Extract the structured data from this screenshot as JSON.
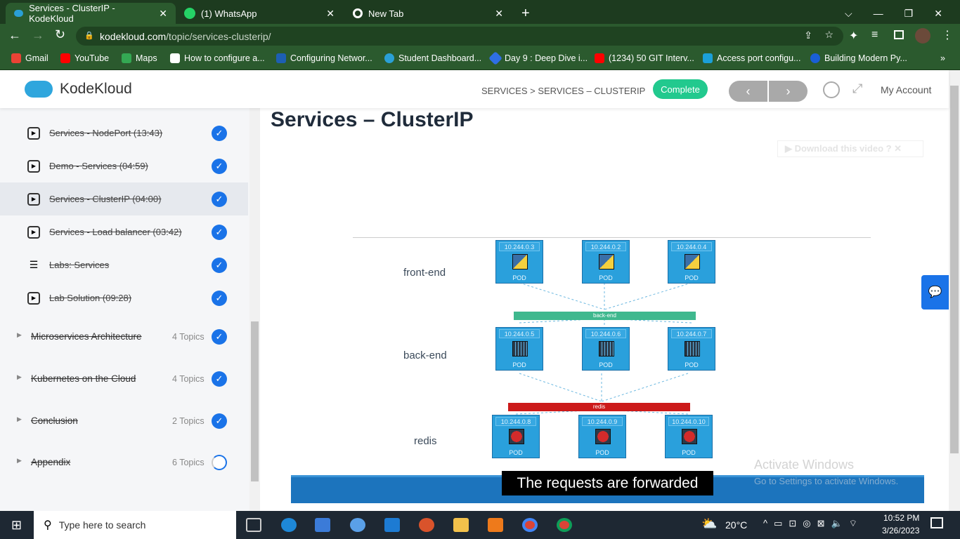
{
  "browser": {
    "tabs": [
      {
        "title": "Services - ClusterIP - KodeKloud",
        "active": true
      },
      {
        "title": "(1) WhatsApp"
      },
      {
        "title": "New Tab"
      }
    ],
    "url_domain": "kodekloud.com",
    "url_path": "/topic/services-clusterip/",
    "bookmarks": [
      "Gmail",
      "YouTube",
      "Maps",
      "How to configure a...",
      "Configuring Networ...",
      "Student Dashboard...",
      "Day 9 : Deep Dive i...",
      "(1234) 50 GIT Interv...",
      "Access port configu...",
      "Building Modern Py..."
    ]
  },
  "header": {
    "logo": "KodeKloud",
    "breadcrumb": "SERVICES > SERVICES – CLUSTERIP",
    "complete": "Complete",
    "prev": "‹",
    "next": "›",
    "account": "My Account"
  },
  "sidebar": {
    "lessons": [
      {
        "label": "Services - NodePort (13:43)",
        "type": "video",
        "done": true
      },
      {
        "label": "Demo - Services (04:59)",
        "type": "video",
        "done": true
      },
      {
        "label": "Services - ClusterIP (04:00)",
        "type": "video",
        "done": true,
        "active": true
      },
      {
        "label": "Services - Load balancer (03:42)",
        "type": "video",
        "done": true
      },
      {
        "label": "Labs: Services",
        "type": "lab",
        "done": true
      },
      {
        "label": "Lab Solution (09:28)",
        "type": "video",
        "done": true
      }
    ],
    "sections": [
      {
        "label": "Microservices Architecture",
        "count": "4 Topics",
        "status": "complete"
      },
      {
        "label": "Kubernetes on the Cloud",
        "count": "4 Topics",
        "status": "complete"
      },
      {
        "label": "Conclusion",
        "count": "2 Topics",
        "status": "complete"
      },
      {
        "label": "Appendix",
        "count": "6 Topics",
        "status": "in-progress"
      }
    ]
  },
  "main": {
    "title": "Services – ClusterIP",
    "download": "Download this video",
    "caption": "The requests are forwarded",
    "watermark": {
      "line1": "Activate Windows",
      "line2": "Go to Settings to activate Windows."
    },
    "diagram": {
      "tiers": [
        {
          "label": "front-end",
          "pods": [
            "10.244.0.3",
            "10.244.0.2",
            "10.244.0.4"
          ],
          "icon": "python"
        },
        {
          "label": "back-end",
          "pods": [
            "10.244.0.5",
            "10.244.0.6",
            "10.244.0.7"
          ],
          "icon": "app"
        },
        {
          "label": "redis",
          "pods": [
            "10.244.0.8",
            "10.244.0.9",
            "10.244.0.10"
          ],
          "icon": "redis"
        }
      ],
      "pod_label": "POD",
      "services": [
        {
          "label": "back-end",
          "color": "#3fb88e"
        },
        {
          "label": "redis",
          "color": "#cc1a1a"
        }
      ]
    }
  },
  "taskbar": {
    "search": "Type here to search",
    "weather": "20°C",
    "time": "10:52 PM",
    "date": "3/26/2023"
  }
}
